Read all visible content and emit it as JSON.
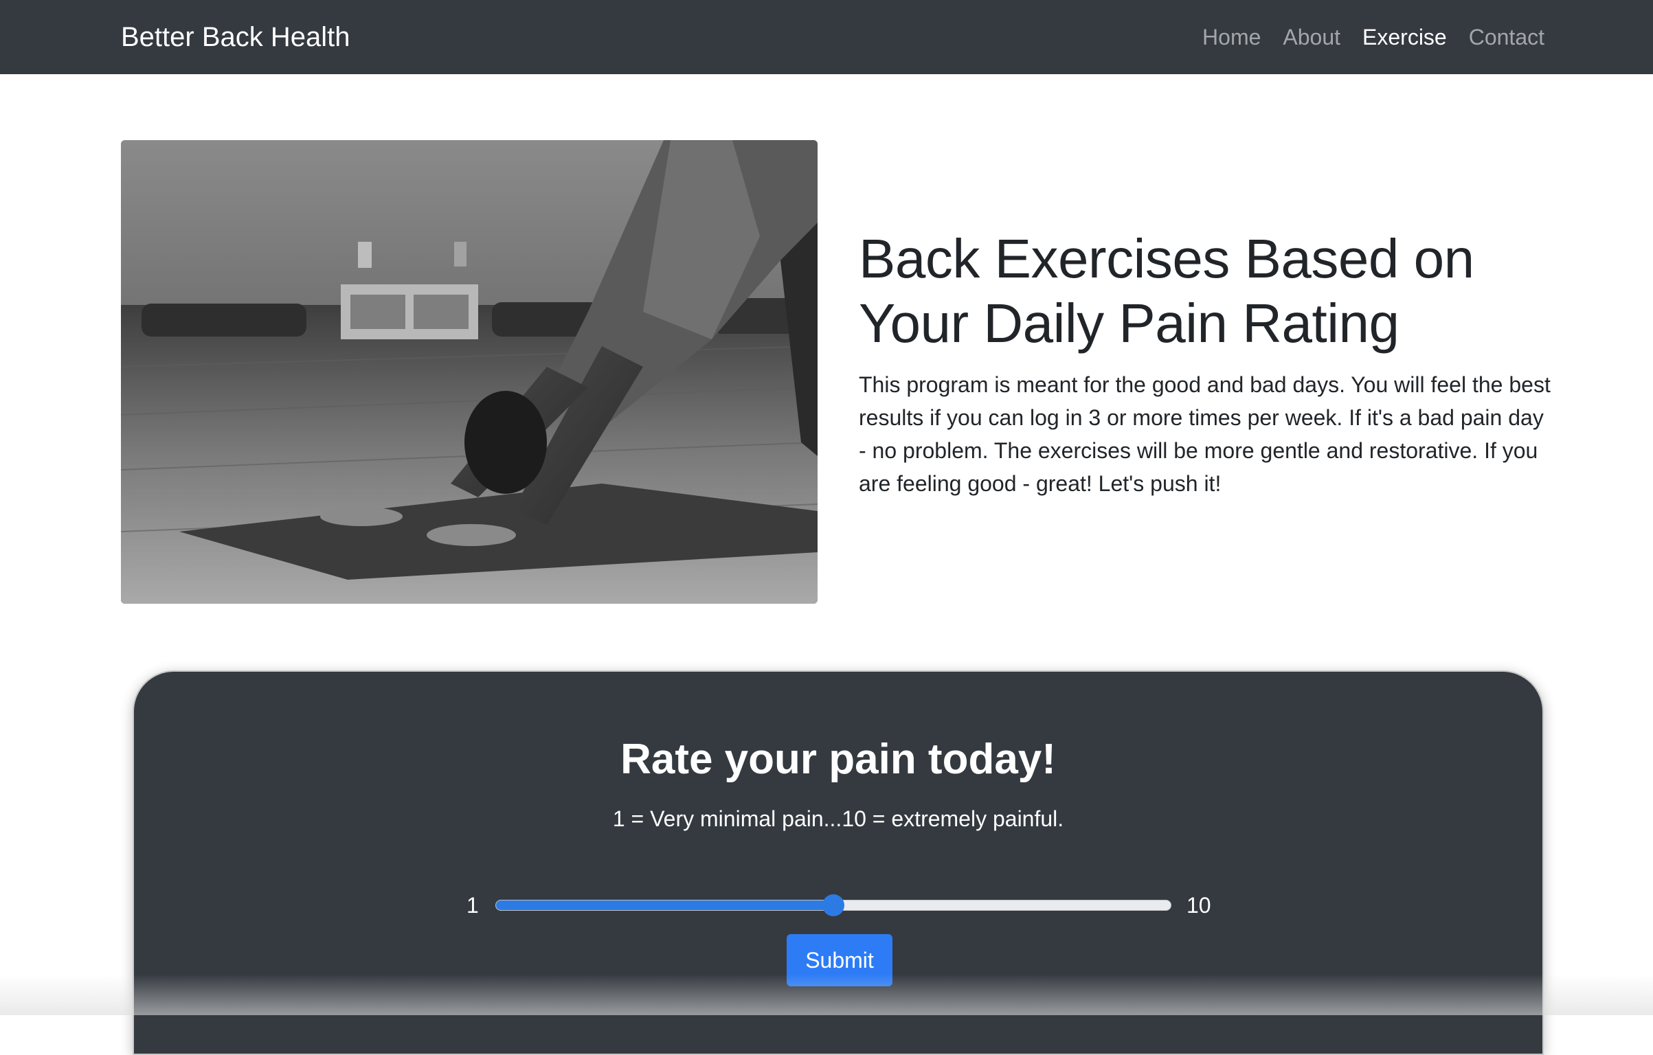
{
  "navbar": {
    "brand": "Better Back Health",
    "links": [
      {
        "label": "Home",
        "active": false
      },
      {
        "label": "About",
        "active": false
      },
      {
        "label": "Exercise",
        "active": true
      },
      {
        "label": "Contact",
        "active": false
      }
    ]
  },
  "hero": {
    "image_alt": "Woman doing downward dog yoga pose on mat",
    "title": "Back Exercises Based on Your Daily Pain Rating",
    "lead": "This program is meant for the good and bad days. You will feel the best results if you can log in 3 or more times per week. If it's a bad pain day - no problem. The exercises will be more gentle and restorative. If you are feeling good - great! Let's push it!"
  },
  "rating": {
    "title": "Rate your pain today!",
    "subtitle": "1 = Very minimal pain...10 = extremely painful.",
    "min_label": "1",
    "max_label": "10",
    "slider_fraction": 0.5,
    "submit_label": "Submit"
  },
  "colors": {
    "navbar_bg": "#343a40",
    "card_bg": "#343a40",
    "accent": "#2d7cf6"
  }
}
